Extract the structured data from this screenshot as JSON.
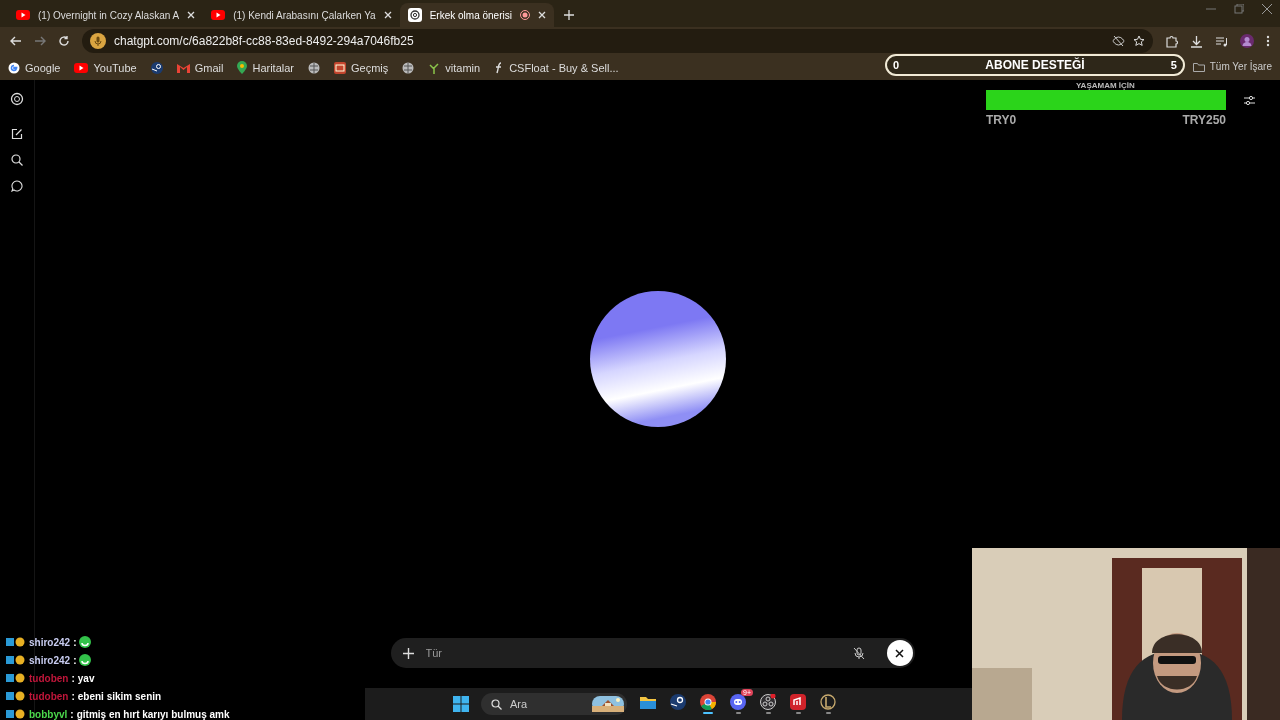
{
  "tabs": [
    {
      "title": "(1) Overnight in Cozy Alaskan A",
      "kind": "youtube",
      "selected": false
    },
    {
      "title": "(1) Kendi Arabasını Çalarken Ya",
      "kind": "youtube",
      "selected": false
    },
    {
      "title": "Erkek olma önerisi",
      "kind": "chatgpt",
      "selected": true
    }
  ],
  "address": "chatgpt.com/c/6a822b8f-cc88-83ed-8492-294a7046fb25",
  "bookmarks": [
    {
      "label": "Google",
      "kind": "google"
    },
    {
      "label": "YouTube",
      "kind": "youtube"
    },
    {
      "kind": "steam"
    },
    {
      "label": "Gmail",
      "kind": "gmail"
    },
    {
      "label": "Haritalar",
      "kind": "maps"
    },
    {
      "kind": "globe"
    },
    {
      "label": "Geçmiş",
      "kind": "history"
    },
    {
      "kind": "globe"
    },
    {
      "label": "vitamin",
      "kind": "plant"
    },
    {
      "label": "CSFloat - Buy & Sell...",
      "kind": "csfloat"
    }
  ],
  "bookmarks_folder": "Tüm Yer İşare",
  "goal": {
    "start": "0",
    "title": "ABONE DESTEĞİ",
    "end": "5"
  },
  "donation": {
    "caption": "YAŞAMAM İÇİN",
    "level": 1,
    "min": "TRY0",
    "max": "TRY250"
  },
  "composer": {
    "placeholder": "Tür"
  },
  "chat": [
    {
      "user": "shiro242",
      "separator": ":",
      "color": "#c8ccf0",
      "kind": "emote"
    },
    {
      "user": "shiro242",
      "separator": ":",
      "color": "#c8ccf0",
      "kind": "emote"
    },
    {
      "user": "tudoben",
      "separator": ":",
      "color": "#c0163a",
      "kind": "text",
      "text": "yav"
    },
    {
      "user": "tudoben",
      "separator": ":",
      "color": "#c0163a",
      "kind": "text",
      "text": "ebeni sikim senin"
    },
    {
      "user": "bobbyvl",
      "separator": ":",
      "color": "#4cd94c",
      "kind": "text",
      "text": "gitmiş en hırt karıyı bulmuş amk"
    }
  ],
  "taskbar": {
    "search_placeholder": "Ara",
    "apps": [
      {
        "kind": "folder",
        "active": false,
        "running": false
      },
      {
        "kind": "steam",
        "active": false,
        "running": false
      },
      {
        "kind": "chrome",
        "active": true,
        "running": true
      },
      {
        "kind": "discord",
        "active": false,
        "running": true,
        "badge": "9+"
      },
      {
        "kind": "obs",
        "active": false,
        "running": true
      },
      {
        "kind": "riot",
        "active": false,
        "running": true
      },
      {
        "kind": "league",
        "active": false,
        "running": true
      }
    ]
  }
}
